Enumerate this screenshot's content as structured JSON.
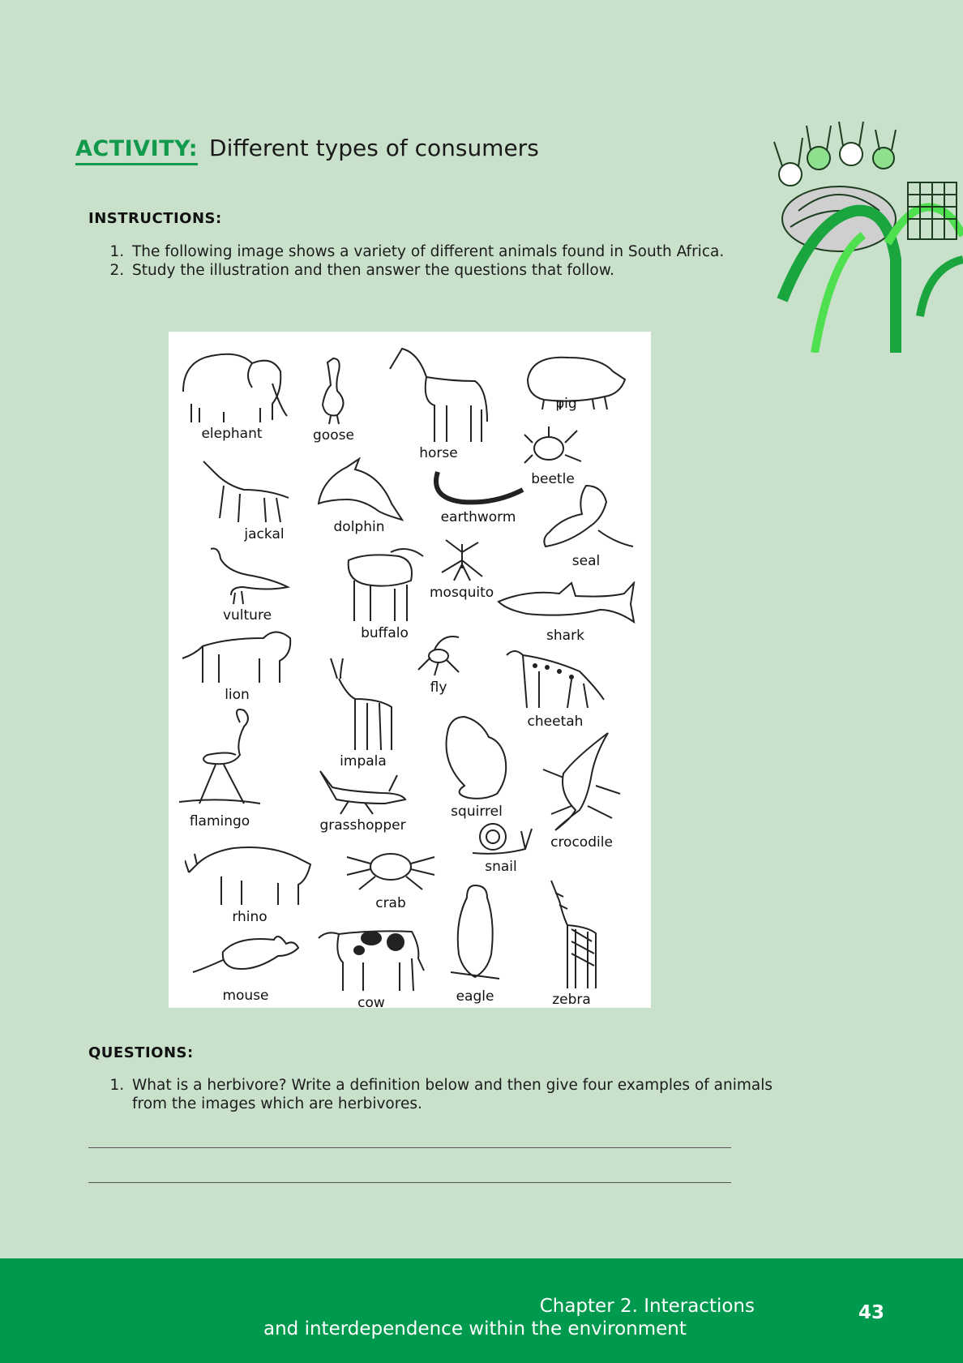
{
  "activity": {
    "tag": "ACTIVITY:",
    "title": "Different types of consumers"
  },
  "instructions": {
    "label": "INSTRUCTIONS:",
    "items": [
      "The following image shows a variety of different animals found in South Africa.",
      "Study the illustration and then answer the questions that follow."
    ]
  },
  "animals": [
    "elephant",
    "goose",
    "horse",
    "pig",
    "beetle",
    "jackal",
    "dolphin",
    "earthworm",
    "seal",
    "vulture",
    "buffalo",
    "mosquito",
    "shark",
    "lion",
    "fly",
    "cheetah",
    "impala",
    "flamingo",
    "squirrel",
    "grasshopper",
    "crocodile",
    "snail",
    "rhino",
    "crab",
    "mouse",
    "cow",
    "eagle",
    "zebra"
  ],
  "questions": {
    "label": "QUESTIONS:",
    "items": [
      "What is a herbivore? Write a definition below and then give four examples of animals from the images which are herbivores."
    ]
  },
  "footer": {
    "chapter": "Chapter 2.   Interactions",
    "subtitle": "and interdependence within the environment",
    "page_number": "43"
  },
  "colors": {
    "background": "#c9e0cb",
    "accent": "#129a4c",
    "footer": "#009a4e"
  }
}
